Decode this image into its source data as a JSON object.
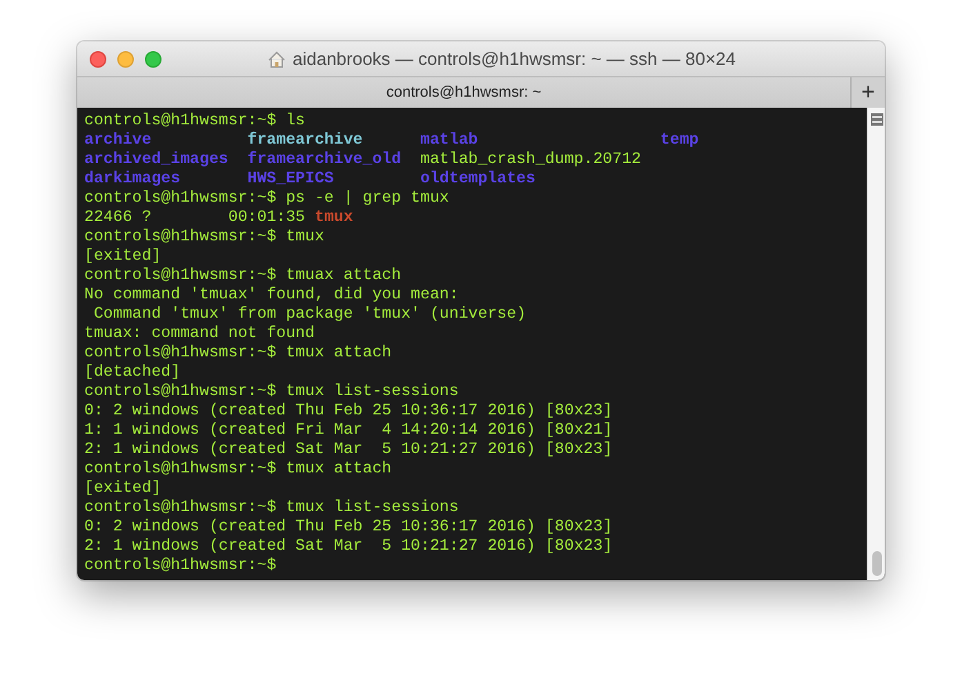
{
  "window": {
    "title": "aidanbrooks — controls@h1hwsmsr: ~ — ssh — 80×24"
  },
  "tabs": [
    {
      "label": "controls@h1hwsmsr: ~"
    }
  ],
  "new_tab_button": {
    "label": "+"
  },
  "terminal": {
    "lines": [
      {
        "kind": "text",
        "segments": [
          {
            "text": "controls@h1hwsmsr:~$ ls",
            "kind": "plain"
          }
        ]
      },
      {
        "kind": "columns",
        "cells": [
          {
            "text": "archive",
            "kind": "dir"
          },
          {
            "text": "framearchive",
            "kind": "dir_other"
          },
          {
            "text": "matlab",
            "kind": "dir"
          },
          {
            "text": "temp",
            "kind": "dir"
          }
        ]
      },
      {
        "kind": "columns",
        "cells": [
          {
            "text": "archived_images",
            "kind": "dir"
          },
          {
            "text": "framearchive_old",
            "kind": "dir"
          },
          {
            "text": "matlab_crash_dump.20712",
            "kind": "plain"
          }
        ]
      },
      {
        "kind": "columns",
        "cells": [
          {
            "text": "darkimages",
            "kind": "dir"
          },
          {
            "text": "HWS_EPICS",
            "kind": "dir"
          },
          {
            "text": "oldtemplates",
            "kind": "dir"
          }
        ]
      },
      {
        "kind": "text",
        "segments": [
          {
            "text": "controls@h1hwsmsr:~$ ps -e | grep tmux",
            "kind": "plain"
          }
        ]
      },
      {
        "kind": "text",
        "segments": [
          {
            "text": "22466 ?        00:01:35 ",
            "kind": "plain"
          },
          {
            "text": "tmux",
            "kind": "match"
          }
        ]
      },
      {
        "kind": "text",
        "segments": [
          {
            "text": "controls@h1hwsmsr:~$ tmux",
            "kind": "plain"
          }
        ]
      },
      {
        "kind": "text",
        "segments": [
          {
            "text": "[exited]",
            "kind": "plain"
          }
        ]
      },
      {
        "kind": "text",
        "segments": [
          {
            "text": "controls@h1hwsmsr:~$ tmuax attach",
            "kind": "plain"
          }
        ]
      },
      {
        "kind": "text",
        "segments": [
          {
            "text": "No command 'tmuax' found, did you mean:",
            "kind": "plain"
          }
        ]
      },
      {
        "kind": "text",
        "segments": [
          {
            "text": " Command 'tmux' from package 'tmux' (universe)",
            "kind": "plain"
          }
        ]
      },
      {
        "kind": "text",
        "segments": [
          {
            "text": "tmuax: command not found",
            "kind": "plain"
          }
        ]
      },
      {
        "kind": "text",
        "segments": [
          {
            "text": "controls@h1hwsmsr:~$ tmux attach",
            "kind": "plain"
          }
        ]
      },
      {
        "kind": "text",
        "segments": [
          {
            "text": "[detached]",
            "kind": "plain"
          }
        ]
      },
      {
        "kind": "text",
        "segments": [
          {
            "text": "controls@h1hwsmsr:~$ tmux list-sessions",
            "kind": "plain"
          }
        ]
      },
      {
        "kind": "text",
        "segments": [
          {
            "text": "0: 2 windows (created Thu Feb 25 10:36:17 2016) [80x23]",
            "kind": "plain"
          }
        ]
      },
      {
        "kind": "text",
        "segments": [
          {
            "text": "1: 1 windows (created Fri Mar  4 14:20:14 2016) [80x21]",
            "kind": "plain"
          }
        ]
      },
      {
        "kind": "text",
        "segments": [
          {
            "text": "2: 1 windows (created Sat Mar  5 10:21:27 2016) [80x23]",
            "kind": "plain"
          }
        ]
      },
      {
        "kind": "text",
        "segments": [
          {
            "text": "controls@h1hwsmsr:~$ tmux attach",
            "kind": "plain"
          }
        ]
      },
      {
        "kind": "text",
        "segments": [
          {
            "text": "[exited]",
            "kind": "plain"
          }
        ]
      },
      {
        "kind": "text",
        "segments": [
          {
            "text": "controls@h1hwsmsr:~$ tmux list-sessions",
            "kind": "plain"
          }
        ]
      },
      {
        "kind": "text",
        "segments": [
          {
            "text": "0: 2 windows (created Thu Feb 25 10:36:17 2016) [80x23]",
            "kind": "plain"
          }
        ]
      },
      {
        "kind": "text",
        "segments": [
          {
            "text": "2: 1 windows (created Sat Mar  5 10:21:27 2016) [80x23]",
            "kind": "plain"
          }
        ]
      },
      {
        "kind": "text",
        "segments": [
          {
            "text": "controls@h1hwsmsr:~$",
            "kind": "plain"
          }
        ]
      }
    ]
  }
}
